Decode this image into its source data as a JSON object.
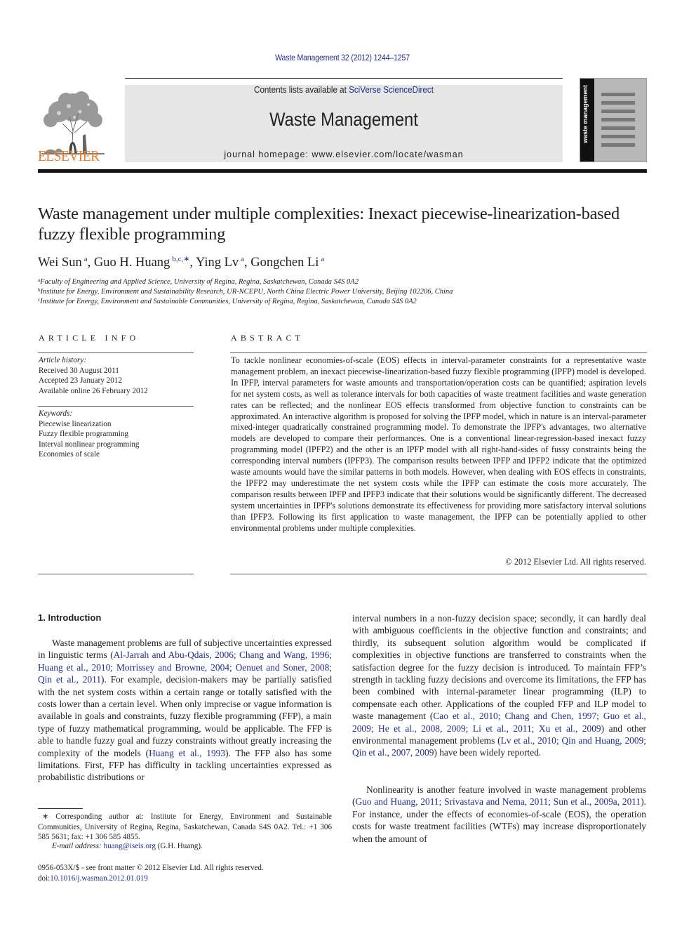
{
  "header": {
    "citation": "Waste Management 32 (2012) 1244–1257",
    "contents_prefix": "Contents lists available at ",
    "contents_link": "SciVerse ScienceDirect",
    "journal_name": "Waste Management",
    "homepage": "journal homepage: www.elsevier.com/locate/wasman",
    "publisher_logo_text": "ELSEVIER",
    "cover_title": "waste management",
    "colors": {
      "link": "#1f2f8a",
      "elsevier_orange": "#f07b22",
      "masthead_bg": "#e6e6e6"
    }
  },
  "article": {
    "title": "Waste management under multiple complexities: Inexact piecewise-linearization-based fuzzy flexible programming",
    "authors": [
      {
        "name": "Wei Sun",
        "affil": "a"
      },
      {
        "name": "Guo H. Huang",
        "affil": "b,c,∗"
      },
      {
        "name": "Ying Lv",
        "affil": "a"
      },
      {
        "name": "Gongchen Li",
        "affil": "a"
      }
    ],
    "affiliations": [
      {
        "mark": "a",
        "text": "Faculty of Engineering and Applied Science, University of Regina, Regina, Saskatchewan, Canada S4S 0A2"
      },
      {
        "mark": "b",
        "text": "Institute for Energy, Environment and Sustainability Research, UR-NCEPU, North China Electric Power University, Beijing 102206, China"
      },
      {
        "mark": "c",
        "text": "Institute for Energy, Environment and Sustainable Communities, University of Regina, Regina, Saskatchewan, Canada S4S 0A2"
      }
    ]
  },
  "article_info": {
    "heading": "ARTICLE INFO",
    "history_label": "Article history:",
    "history": [
      "Received 30 August 2011",
      "Accepted 23 January 2012",
      "Available online 26 February 2012"
    ],
    "keywords_label": "Keywords:",
    "keywords": [
      "Piecewise linearization",
      "Fuzzy flexible programming",
      "Interval nonlinear programming",
      "Economies of scale"
    ]
  },
  "abstract": {
    "heading": "ABSTRACT",
    "text": "To tackle nonlinear economies-of-scale (EOS) effects in interval-parameter constraints for a representative waste management problem, an inexact piecewise-linearization-based fuzzy flexible programming (IPFP) model is developed. In IPFP, interval parameters for waste amounts and transportation/operation costs can be quantified; aspiration levels for net system costs, as well as tolerance intervals for both capacities of waste treatment facilities and waste generation rates can be reflected; and the nonlinear EOS effects transformed from objective function to constraints can be approximated. An interactive algorithm is proposed for solving the IPFP model, which in nature is an interval-parameter mixed-integer quadratically constrained programming model. To demonstrate the IPFP's advantages, two alternative models are developed to compare their performances. One is a conventional linear-regression-based inexact fuzzy programming model (IPFP2) and the other is an IPFP model with all right-hand-sides of fussy constraints being the corresponding interval numbers (IPFP3). The comparison results between IPFP and IPFP2 indicate that the optimized waste amounts would have the similar patterns in both models. However, when dealing with EOS effects in constraints, the IPFP2 may underestimate the net system costs while the IPFP can estimate the costs more accurately. The comparison results between IPFP and IPFP3 indicate that their solutions would be significantly different. The decreased system uncertainties in IPFP's solutions demonstrate its effectiveness for providing more satisfactory interval solutions than IPFP3. Following its first application to waste management, the IPFP can be potentially applied to other environmental problems under multiple complexities.",
    "copyright": "© 2012 Elsevier Ltd. All rights reserved."
  },
  "body": {
    "section_heading": "1. Introduction",
    "col1": [
      {
        "t": "Waste management problems are full of subjective uncertainties expressed in linguistic terms ("
      },
      {
        "link": "Al-Jarrah and Abu-Qdais, 2006; Chang and Wang, 1996; Huang et al., 2010; Morrissey and Browne, 2004; Oenuet and Soner, 2008; Qin et al., 2011"
      },
      {
        "t": "). For example, decision-makers may be partially satisfied with the net system costs within a certain range or totally satisfied with the costs lower than a certain level. When only imprecise or vague information is available in goals and constraints, fuzzy flexible programming (FFP), a main type of fuzzy mathematical programming, would be applicable. The FFP is able to handle fuzzy goal and fuzzy constraints without greatly increasing the complexity of the models ("
      },
      {
        "link": "Huang et al., 1993"
      },
      {
        "t": "). The FFP also has some limitations. First, FFP has difficulty in tackling uncertainties expressed as probabilistic distributions or"
      }
    ],
    "col2a": [
      {
        "t": "interval numbers in a non-fuzzy decision space; secondly, it can hardly deal with ambiguous coefficients in the objective function and constraints; and thirdly, its subsequent solution algorithm would be complicated if complexities in objective functions are transferred to constraints when the satisfaction degree for the fuzzy decision is introduced. To maintain FFP’s strength in tackling fuzzy decisions and overcome its limitations, the FFP has been combined with internal-parameter linear programming (ILP) to compensate each other. Applications of the coupled FFP and ILP model to waste management ("
      },
      {
        "link": "Cao et al., 2010; Chang and Chen, 1997; Guo et al., 2009; He et al., 2008, 2009; Li et al., 2011; Xu et al., 2009"
      },
      {
        "t": ") and other environmental management problems ("
      },
      {
        "link": "Lv et al., 2010; Qin and Huang, 2009; Qin et al., 2007, 2009"
      },
      {
        "t": ") have been widely reported."
      }
    ],
    "col2b": [
      {
        "t": "Nonlinearity is another feature involved in waste management problems ("
      },
      {
        "link": "Guo and Huang, 2011; Srivastava and Nema, 2011; Sun et al., 2009a, 2011"
      },
      {
        "t": "). For instance, under the effects of economies-of-scale (EOS), the operation costs for waste treatment facilities (WTFs) may increase disproportionately when the amount of"
      }
    ]
  },
  "footnotes": {
    "corresponding": "∗ Corresponding author at: Institute for Energy, Environment and Sustainable Communities, University of Regina, Regina, Saskatchewan, Canada S4S 0A2. Tel.: +1 306 585 5631; fax: +1 306 585 4855.",
    "email_label": "E-mail address: ",
    "email": "huang@iseis.org",
    "email_suffix": " (G.H. Huang).",
    "issn": "0956-053X/$ - see front matter © 2012 Elsevier Ltd. All rights reserved.",
    "doi_prefix": "doi:",
    "doi": "10.1016/j.wasman.2012.01.019"
  }
}
